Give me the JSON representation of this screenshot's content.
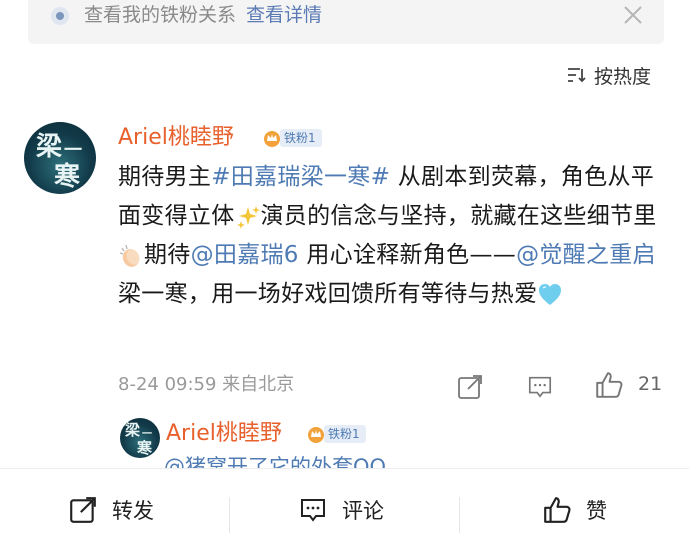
{
  "notice": {
    "text": "查看我的铁粉关系",
    "link": "查看详情"
  },
  "sort": {
    "label": "按热度"
  },
  "comment": {
    "username": "Ariel桃睦野",
    "badge": "铁粉1",
    "avatar_chars": [
      "梁",
      "一",
      "寒"
    ],
    "content": {
      "t1": "期待男主",
      "tag": "#田嘉瑞梁一寒#",
      "t2": " 从剧本到荧幕，角色从平面变得立体",
      "t3": "演员的信念与坚持，就藏在这些细节里",
      "t4": "期待",
      "mention1": "@田嘉瑞6",
      "t5": " 用心诠释新角色——",
      "mention2": "@觉醒之重启",
      "t6": " 梁一寒，用一场好戏回馈所有等待与热爱"
    },
    "meta": "8-24 09:59 来自北京",
    "likes": "21"
  },
  "reply": {
    "username": "Ariel桃睦野",
    "badge": "铁粉1",
    "avatar_chars": [
      "梁",
      "一",
      "寒"
    ],
    "preview": "@猪窝开了它的外套QQ"
  },
  "bottom": {
    "repost": "转发",
    "comment": "评论",
    "like": "赞"
  },
  "colors": {
    "username": "#e8602c",
    "link": "#4f7bb4",
    "meta": "#9a9a9a"
  },
  "icons": [
    "info-dot-icon",
    "close-icon",
    "sort-icon",
    "sparkles-icon",
    "clap-icon",
    "blue-heart-icon",
    "share-icon",
    "comment-icon",
    "thumb-up-icon",
    "crown-icon"
  ]
}
